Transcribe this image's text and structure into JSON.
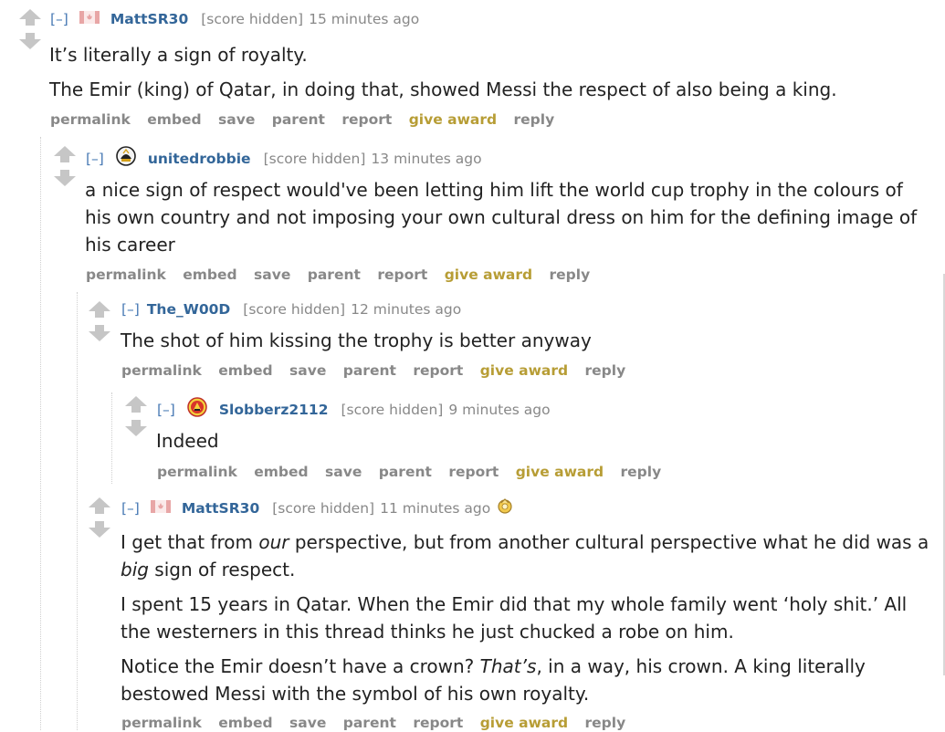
{
  "common": {
    "expand": "[–]",
    "score_hidden": "[score hidden]",
    "buttons": {
      "permalink": "permalink",
      "embed": "embed",
      "save": "save",
      "parent": "parent",
      "report": "report",
      "give_award": "give award",
      "reply": "reply"
    }
  },
  "colors": {
    "author": "#336699",
    "award": "#b79d35",
    "meta": "#888888"
  },
  "comments": [
    {
      "author": "MattSR30",
      "flair_icon": "canada-flag-icon",
      "time": "15 minutes ago",
      "paragraphs": [
        "It’s literally a sign of royalty.",
        "The Emir (king) of Qatar, in doing that, showed Messi the respect of also being a king."
      ]
    },
    {
      "author": "unitedrobbie",
      "flair_icon": "newcastle-crest-icon",
      "time": "13 minutes ago",
      "paragraphs": [
        "a nice sign of respect would've been letting him lift the world cup trophy in the colours of his own country and not imposing your own cultural dress on him for the defining image of his career"
      ]
    },
    {
      "author": "The_W00D",
      "time": "12 minutes ago",
      "paragraphs": [
        "The shot of him kissing the trophy is better anyway"
      ]
    },
    {
      "author": "Slobberz2112",
      "flair_icon": "manchester-united-crest-icon",
      "time": "9 minutes ago",
      "paragraphs": [
        "Indeed"
      ]
    },
    {
      "author": "MattSR30",
      "flair_icon": "canada-flag-icon",
      "time": "11 minutes ago",
      "award_icon": "award-icon",
      "p1": {
        "a": "I get that from ",
        "em1": "our",
        "b": " perspective, but from another cultural perspective what he did was a ",
        "em2": "big",
        "c": " sign of respect."
      },
      "p2": "I spent 15 years in Qatar. When the Emir did that my whole family went ‘holy shit.’ All the westerners in this thread thinks he just chucked a robe on him.",
      "p3": {
        "a": "Notice the Emir doesn’t have a crown? ",
        "em": "That’s",
        "b": ", in a way, his crown. A king literally bestowed Messi with the symbol of his own royalty."
      }
    }
  ]
}
